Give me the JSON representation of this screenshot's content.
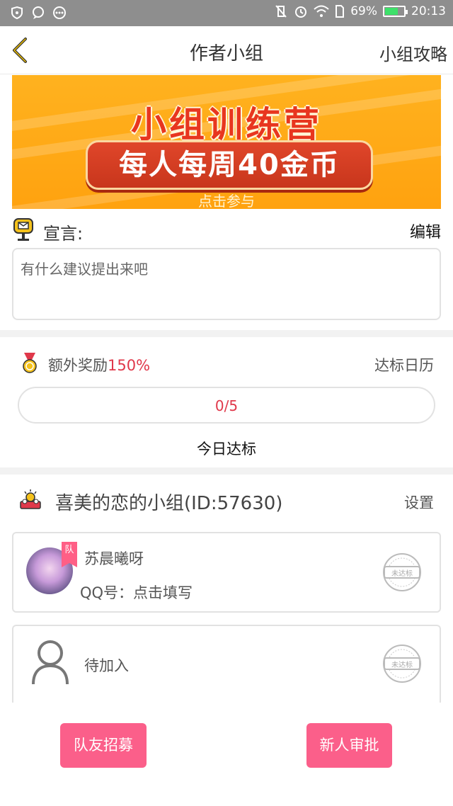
{
  "status_bar": {
    "battery": "69%",
    "battery_level": 0.69,
    "time": "20:13"
  },
  "nav": {
    "title": "作者小组",
    "right_link": "小组攻略"
  },
  "banner": {
    "title": "小组训练营",
    "subtitle": "每人每周40金币",
    "cta": "点击参与"
  },
  "declaration": {
    "label": "宣言:",
    "edit": "编辑",
    "text": "有什么建议提出来吧"
  },
  "reward": {
    "label": "额外奖励",
    "percent": "150%",
    "calendar": "达标日历",
    "progress_text": "0/5",
    "progress_fraction": 0.0,
    "today": "今日达标"
  },
  "group": {
    "title": "喜美的恋的小组(ID:57630)",
    "settings": "设置"
  },
  "members": [
    {
      "badge": "队",
      "name": "苏晨曦呀",
      "qq": "QQ号：点击填写",
      "status": "未达标"
    },
    {
      "name": "待加入",
      "status": "未达标"
    }
  ],
  "buttons": {
    "recruit": "队友招募",
    "approve": "新人审批"
  },
  "colors": {
    "accent_pink": "#fb5f8a",
    "highlight_red": "#e0384a",
    "banner_orange": "#ffa20f"
  }
}
